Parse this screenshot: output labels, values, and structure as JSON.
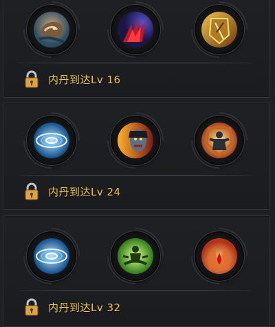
{
  "tiers": [
    {
      "requirement": "内丹到达Lv 16",
      "skills": [
        {
          "icon": "beast-skull-skill-icon"
        },
        {
          "icon": "red-claw-skill-icon"
        },
        {
          "icon": "golden-shield-skill-icon"
        }
      ]
    },
    {
      "requirement": "内丹到达Lv 24",
      "skills": [
        {
          "icon": "blue-vortex-skill-icon"
        },
        {
          "icon": "demon-face-skill-icon"
        },
        {
          "icon": "armored-guardian-skill-icon"
        }
      ]
    },
    {
      "requirement": "内丹到达Lv 32",
      "skills": [
        {
          "icon": "blue-vortex-skill-icon"
        },
        {
          "icon": "green-meditation-skill-icon"
        },
        {
          "icon": "flame-hands-skill-icon"
        }
      ]
    }
  ],
  "colors": {
    "background": "#1f2023",
    "requirement_text": "#f0c84a",
    "lock": "#d9a441"
  }
}
